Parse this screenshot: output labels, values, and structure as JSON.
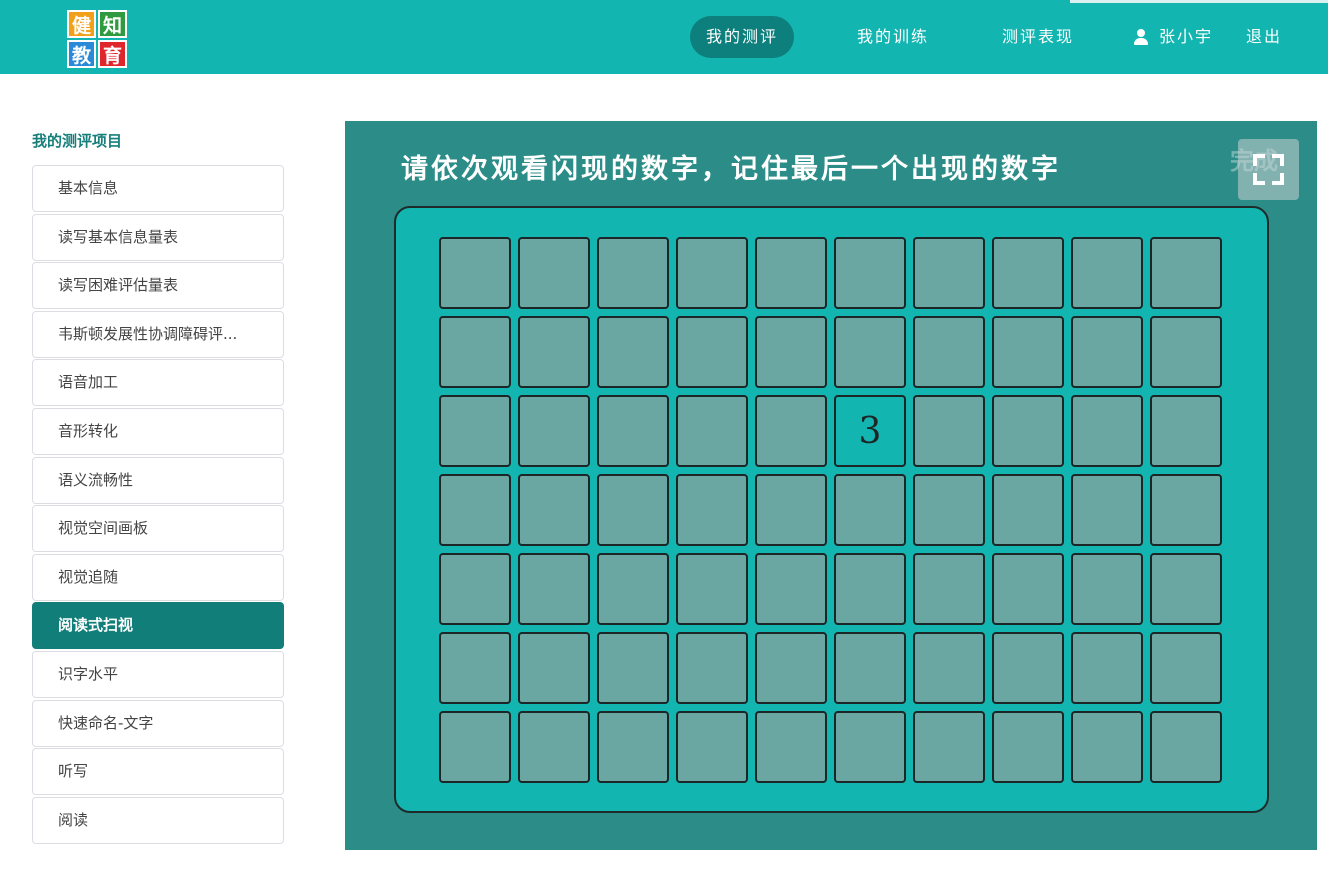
{
  "header": {
    "logo_chars": [
      "健",
      "知",
      "教",
      "育"
    ],
    "nav": [
      {
        "label": "我的测评",
        "active": true
      },
      {
        "label": "我的训练",
        "active": false
      },
      {
        "label": "测评表现",
        "active": false
      }
    ],
    "user_name": "张小宇",
    "logout_label": "退出"
  },
  "sidebar": {
    "title": "我的测评项目",
    "items": [
      {
        "label": "基本信息"
      },
      {
        "label": "读写基本信息量表"
      },
      {
        "label": "读写困难评估量表"
      },
      {
        "label": "韦斯顿发展性协调障碍评..."
      },
      {
        "label": "语音加工"
      },
      {
        "label": "音形转化"
      },
      {
        "label": "语义流畅性"
      },
      {
        "label": "视觉空间画板"
      },
      {
        "label": "视觉追随"
      },
      {
        "label": "阅读式扫视"
      },
      {
        "label": "识字水平"
      },
      {
        "label": "快速命名-文字"
      },
      {
        "label": "听写"
      },
      {
        "label": "阅读"
      }
    ],
    "active_index": 9
  },
  "test": {
    "instruction": "请依次观看闪现的数字，记住最后一个出现的数字",
    "faint_label": "完成",
    "grid_rows": 7,
    "grid_cols": 10,
    "flashed_cell": {
      "row": 2,
      "col": 5,
      "value": "3"
    }
  },
  "colors": {
    "header_bg": "#13b5b1",
    "nav_active_bg": "#0d7f7c",
    "panel_bg": "#2b8c88",
    "board_bg": "#13b5b1",
    "cell_bg": "#6aa7a3",
    "sidebar_active_bg": "#127e79"
  }
}
